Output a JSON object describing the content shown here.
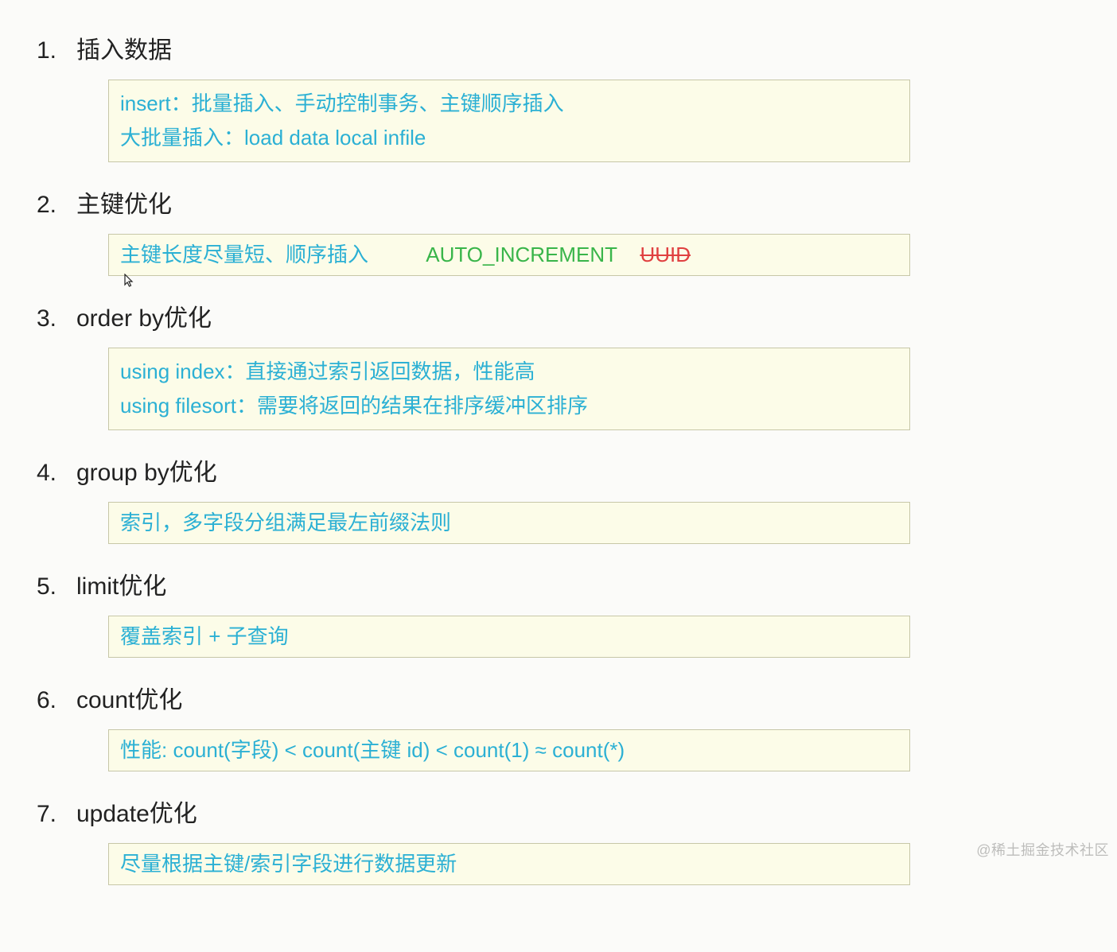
{
  "items": [
    {
      "num": "1.",
      "title": "插入数据",
      "box": {
        "tight": false,
        "lines": [
          [
            {
              "cls": "cyan",
              "text": "insert：批量插入、手动控制事务、主键顺序插入"
            }
          ],
          [
            {
              "cls": "cyan",
              "text": "大批量插入：load  data  local  infile"
            }
          ]
        ]
      },
      "cursor": false
    },
    {
      "num": "2.",
      "title": "主键优化",
      "box": {
        "tight": true,
        "lines": [
          [
            {
              "cls": "cyan",
              "text": "主键长度尽量短、顺序插入"
            },
            {
              "cls": "gap",
              "text": "          "
            },
            {
              "cls": "green",
              "text": "AUTO_INCREMENT"
            },
            {
              "cls": "gap",
              "text": "    "
            },
            {
              "cls": "redstrike",
              "text": "UUID"
            }
          ]
        ]
      },
      "cursor": true
    },
    {
      "num": "3.",
      "title": "order by优化",
      "box": {
        "tight": false,
        "lines": [
          [
            {
              "cls": "cyan",
              "text": "using index：直接通过索引返回数据，性能高"
            }
          ],
          [
            {
              "cls": "cyan",
              "text": "using filesort：需要将返回的结果在排序缓冲区排序"
            }
          ]
        ]
      },
      "cursor": false
    },
    {
      "num": "4.",
      "title": "group by优化",
      "box": {
        "tight": true,
        "lines": [
          [
            {
              "cls": "cyan",
              "text": "索引，多字段分组满足最左前缀法则"
            }
          ]
        ]
      },
      "cursor": false
    },
    {
      "num": "5.",
      "title": "limit优化",
      "box": {
        "tight": true,
        "lines": [
          [
            {
              "cls": "cyan",
              "text": "覆盖索引 + 子查询"
            }
          ]
        ]
      },
      "cursor": false
    },
    {
      "num": "6.",
      "title": "count优化",
      "box": {
        "tight": true,
        "lines": [
          [
            {
              "cls": "cyan",
              "text": "性能: count(字段) < count(主键 id) < count(1) ≈ count(*)"
            }
          ]
        ]
      },
      "cursor": false
    },
    {
      "num": "7.",
      "title": "update优化",
      "box": {
        "tight": true,
        "lines": [
          [
            {
              "cls": "cyan",
              "text": "尽量根据主键/索引字段进行数据更新"
            }
          ]
        ]
      },
      "cursor": false
    }
  ],
  "watermark": "@稀土掘金技术社区"
}
